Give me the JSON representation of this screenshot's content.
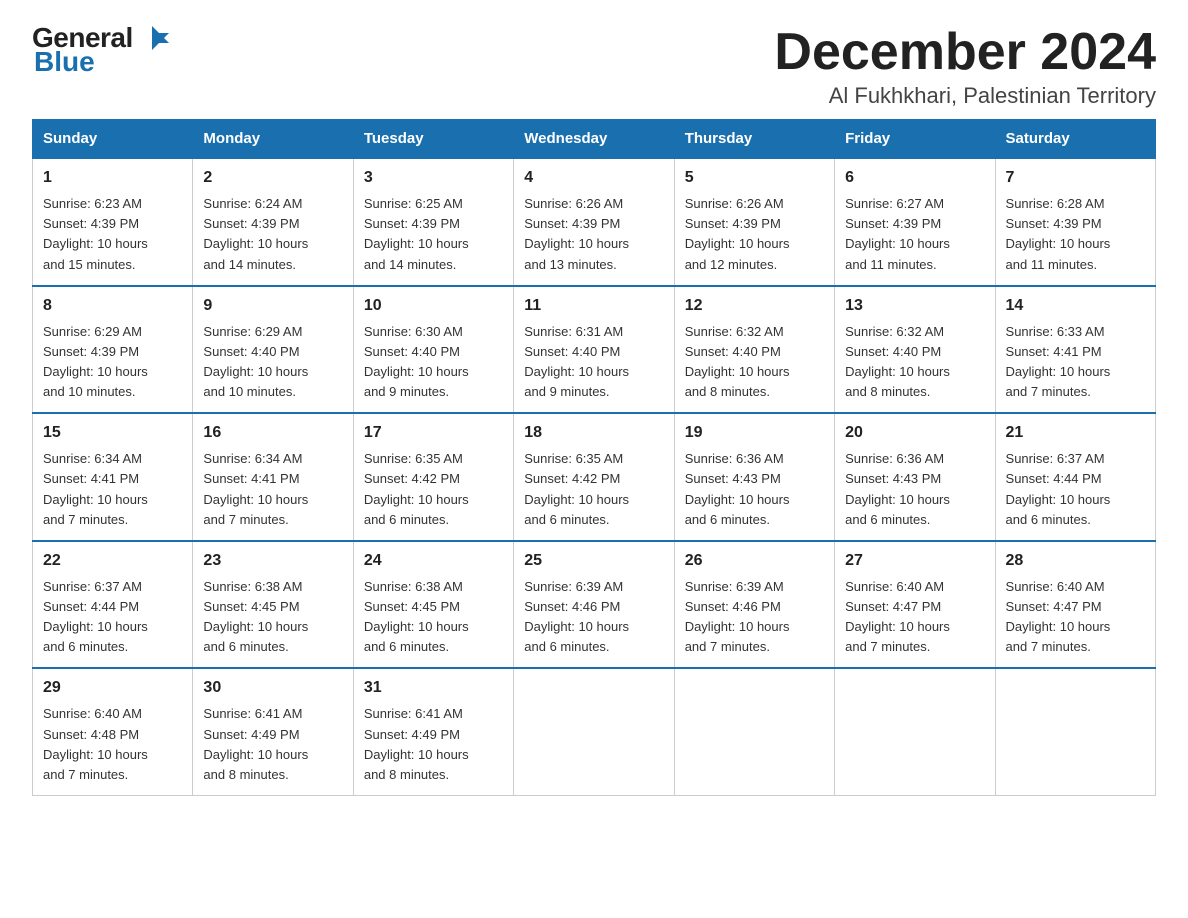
{
  "header": {
    "logo_general": "General",
    "logo_blue": "Blue",
    "month_title": "December 2024",
    "subtitle": "Al Fukhkhari, Palestinian Territory"
  },
  "days_of_week": [
    "Sunday",
    "Monday",
    "Tuesday",
    "Wednesday",
    "Thursday",
    "Friday",
    "Saturday"
  ],
  "weeks": [
    [
      {
        "day": "1",
        "sunrise": "6:23 AM",
        "sunset": "4:39 PM",
        "daylight": "10 hours and 15 minutes."
      },
      {
        "day": "2",
        "sunrise": "6:24 AM",
        "sunset": "4:39 PM",
        "daylight": "10 hours and 14 minutes."
      },
      {
        "day": "3",
        "sunrise": "6:25 AM",
        "sunset": "4:39 PM",
        "daylight": "10 hours and 14 minutes."
      },
      {
        "day": "4",
        "sunrise": "6:26 AM",
        "sunset": "4:39 PM",
        "daylight": "10 hours and 13 minutes."
      },
      {
        "day": "5",
        "sunrise": "6:26 AM",
        "sunset": "4:39 PM",
        "daylight": "10 hours and 12 minutes."
      },
      {
        "day": "6",
        "sunrise": "6:27 AM",
        "sunset": "4:39 PM",
        "daylight": "10 hours and 11 minutes."
      },
      {
        "day": "7",
        "sunrise": "6:28 AM",
        "sunset": "4:39 PM",
        "daylight": "10 hours and 11 minutes."
      }
    ],
    [
      {
        "day": "8",
        "sunrise": "6:29 AM",
        "sunset": "4:39 PM",
        "daylight": "10 hours and 10 minutes."
      },
      {
        "day": "9",
        "sunrise": "6:29 AM",
        "sunset": "4:40 PM",
        "daylight": "10 hours and 10 minutes."
      },
      {
        "day": "10",
        "sunrise": "6:30 AM",
        "sunset": "4:40 PM",
        "daylight": "10 hours and 9 minutes."
      },
      {
        "day": "11",
        "sunrise": "6:31 AM",
        "sunset": "4:40 PM",
        "daylight": "10 hours and 9 minutes."
      },
      {
        "day": "12",
        "sunrise": "6:32 AM",
        "sunset": "4:40 PM",
        "daylight": "10 hours and 8 minutes."
      },
      {
        "day": "13",
        "sunrise": "6:32 AM",
        "sunset": "4:40 PM",
        "daylight": "10 hours and 8 minutes."
      },
      {
        "day": "14",
        "sunrise": "6:33 AM",
        "sunset": "4:41 PM",
        "daylight": "10 hours and 7 minutes."
      }
    ],
    [
      {
        "day": "15",
        "sunrise": "6:34 AM",
        "sunset": "4:41 PM",
        "daylight": "10 hours and 7 minutes."
      },
      {
        "day": "16",
        "sunrise": "6:34 AM",
        "sunset": "4:41 PM",
        "daylight": "10 hours and 7 minutes."
      },
      {
        "day": "17",
        "sunrise": "6:35 AM",
        "sunset": "4:42 PM",
        "daylight": "10 hours and 6 minutes."
      },
      {
        "day": "18",
        "sunrise": "6:35 AM",
        "sunset": "4:42 PM",
        "daylight": "10 hours and 6 minutes."
      },
      {
        "day": "19",
        "sunrise": "6:36 AM",
        "sunset": "4:43 PM",
        "daylight": "10 hours and 6 minutes."
      },
      {
        "day": "20",
        "sunrise": "6:36 AM",
        "sunset": "4:43 PM",
        "daylight": "10 hours and 6 minutes."
      },
      {
        "day": "21",
        "sunrise": "6:37 AM",
        "sunset": "4:44 PM",
        "daylight": "10 hours and 6 minutes."
      }
    ],
    [
      {
        "day": "22",
        "sunrise": "6:37 AM",
        "sunset": "4:44 PM",
        "daylight": "10 hours and 6 minutes."
      },
      {
        "day": "23",
        "sunrise": "6:38 AM",
        "sunset": "4:45 PM",
        "daylight": "10 hours and 6 minutes."
      },
      {
        "day": "24",
        "sunrise": "6:38 AM",
        "sunset": "4:45 PM",
        "daylight": "10 hours and 6 minutes."
      },
      {
        "day": "25",
        "sunrise": "6:39 AM",
        "sunset": "4:46 PM",
        "daylight": "10 hours and 6 minutes."
      },
      {
        "day": "26",
        "sunrise": "6:39 AM",
        "sunset": "4:46 PM",
        "daylight": "10 hours and 7 minutes."
      },
      {
        "day": "27",
        "sunrise": "6:40 AM",
        "sunset": "4:47 PM",
        "daylight": "10 hours and 7 minutes."
      },
      {
        "day": "28",
        "sunrise": "6:40 AM",
        "sunset": "4:47 PM",
        "daylight": "10 hours and 7 minutes."
      }
    ],
    [
      {
        "day": "29",
        "sunrise": "6:40 AM",
        "sunset": "4:48 PM",
        "daylight": "10 hours and 7 minutes."
      },
      {
        "day": "30",
        "sunrise": "6:41 AM",
        "sunset": "4:49 PM",
        "daylight": "10 hours and 8 minutes."
      },
      {
        "day": "31",
        "sunrise": "6:41 AM",
        "sunset": "4:49 PM",
        "daylight": "10 hours and 8 minutes."
      },
      null,
      null,
      null,
      null
    ]
  ],
  "labels": {
    "sunrise": "Sunrise:",
    "sunset": "Sunset:",
    "daylight": "Daylight:"
  }
}
